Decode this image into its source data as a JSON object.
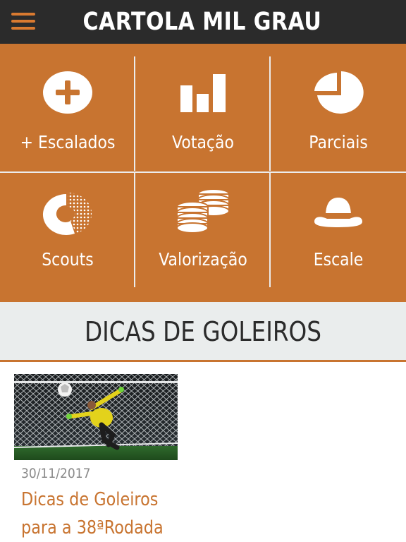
{
  "header": {
    "title": "CARTOLA MIL GRAU",
    "menu_icon": "hamburger-menu-icon",
    "accent_color": "#d97a30",
    "background_color": "#2b2b2b"
  },
  "menu_grid": {
    "background_color": "#c87430",
    "items": [
      {
        "label": "+ Escalados",
        "icon": "plus-circle-icon"
      },
      {
        "label": "Votação",
        "icon": "bar-chart-icon"
      },
      {
        "label": "Parciais",
        "icon": "pie-chart-icon"
      },
      {
        "label": "Scouts",
        "icon": "donut-chart-icon"
      },
      {
        "label": "Valorização",
        "icon": "coin-stacks-icon"
      },
      {
        "label": "Escale",
        "icon": "hat-icon"
      }
    ]
  },
  "section": {
    "title": "DICAS DE GOLEIROS"
  },
  "articles": [
    {
      "date": "30/11/2017",
      "title_line1": "Dicas de Goleiros",
      "title_line2": "para a 38ªRodada",
      "thumbnail": "goalkeeper-diving-photo"
    }
  ]
}
